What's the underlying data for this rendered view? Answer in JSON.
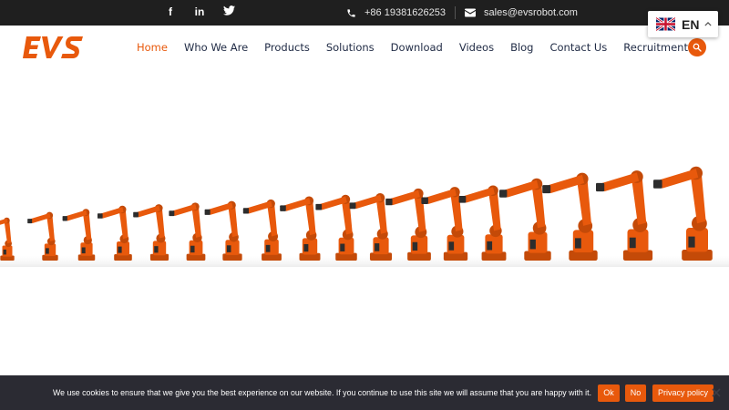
{
  "topbar": {
    "social_icons": [
      "facebook-icon",
      "linkedin-icon",
      "twitter-icon"
    ],
    "social_glyphs": [
      "f",
      "in",
      "t"
    ],
    "phone": "+86 19381626253",
    "email": "sales@evsrobot.com"
  },
  "language": {
    "code": "EN",
    "flag": "uk-flag-icon"
  },
  "header": {
    "logo_text": "EVS",
    "nav": [
      {
        "label": "Home",
        "active": true
      },
      {
        "label": "Who We Are",
        "active": false
      },
      {
        "label": "Products",
        "active": false
      },
      {
        "label": "Solutions",
        "active": false
      },
      {
        "label": "Download",
        "active": false
      },
      {
        "label": "Videos",
        "active": false
      },
      {
        "label": "Blog",
        "active": false
      },
      {
        "label": "Contact Us",
        "active": false
      },
      {
        "label": "Recruitment",
        "active": false
      }
    ]
  },
  "colors": {
    "accent": "#e8590c",
    "topbar": "#1f1f1f",
    "cookie_bar": "#2b2b33",
    "nav_text": "#1f2a44"
  },
  "cookie": {
    "message": "We use cookies to ensure that we give you the best experience on our website. If you continue to use this site we will assume that you are happy with it.",
    "ok_label": "Ok",
    "no_label": "No",
    "policy_label": "Privacy policy"
  }
}
